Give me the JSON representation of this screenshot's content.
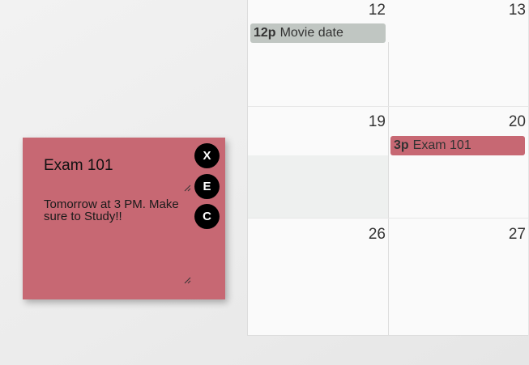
{
  "calendar": {
    "days": [
      {
        "number": "12"
      },
      {
        "number": "13"
      },
      {
        "number": "19"
      },
      {
        "number": "20"
      },
      {
        "number": "26"
      },
      {
        "number": "27"
      }
    ],
    "events": [
      {
        "time": "12p",
        "title": "Movie date",
        "color": "#c0c6c2"
      },
      {
        "time": "3p",
        "title": "Exam 101",
        "color": "#c76873"
      }
    ]
  },
  "note": {
    "title": "Exam 101",
    "body": "Tomorrow at 3 PM. Make sure to Study!!",
    "color": "#c76873",
    "buttons": {
      "close": "X",
      "edit": "E",
      "color": "C"
    }
  }
}
